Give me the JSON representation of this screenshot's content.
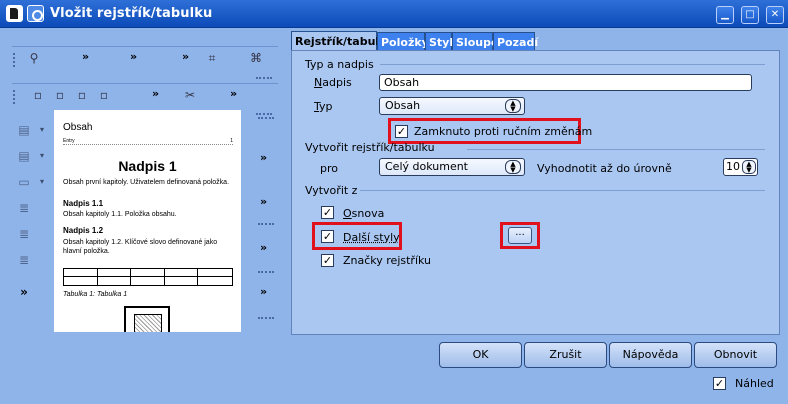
{
  "window": {
    "title": "Vložit rejstřík/tabulku",
    "btn_min": "▁",
    "btn_max": "□",
    "btn_close": "✕"
  },
  "preview": {
    "toc_title": "Obsah",
    "entry_label": "Entry",
    "entry_page": "1",
    "heading": "Nadpis 1",
    "text1": "Obsah první kapitoly. Uživatelem definovaná položka.",
    "heading11": "Nadpis 1.1",
    "text11": "Obsah kapitoly 1.1. Položka obsahu.",
    "heading12": "Nadpis 1.2",
    "text12": "Obsah kapitoly 1.2. Klíčové slovo definované jako hlavní položka.",
    "caption": "Tabulka 1: Tabulka 1"
  },
  "tabs": [
    {
      "label": "Rejstřík/tabulka",
      "active": true
    },
    {
      "label": "Položky",
      "active": false
    },
    {
      "label": "Styly",
      "active": false
    },
    {
      "label": "Sloupce",
      "active": false
    },
    {
      "label": "Pozadí",
      "active": false
    }
  ],
  "type_section": {
    "title": "Typ a nadpis",
    "title_label": "Nadpis",
    "title_value": "Obsah",
    "type_label": "Typ",
    "type_value": "Obsah",
    "protect_label": "Zamknuto proti ručním změnám",
    "protect_checked": true
  },
  "create_section": {
    "title": "Vytvořit rejstřík/tabulku",
    "for_label": "pro",
    "for_value": "Celý dokument",
    "eval_label": "Vyhodnotit až do úrovně",
    "eval_value": "10"
  },
  "from_section": {
    "title": "Vytvořit z",
    "outline_label": "Osnova",
    "outline_checked": true,
    "other_styles_label": "Další styly",
    "other_styles_checked": true,
    "styles_button": "...",
    "marks_label": "Značky rejstříku",
    "marks_checked": true
  },
  "footer": {
    "ok": "OK",
    "cancel": "Zrušit",
    "help": "Nápověda",
    "reset": "Obnovit",
    "preview_label": "Náhled",
    "preview_checked": true
  },
  "colors": {
    "highlight": "#e0101c",
    "titlebar": "#0c4bb8",
    "tab_inactive": "#3d81ee"
  }
}
